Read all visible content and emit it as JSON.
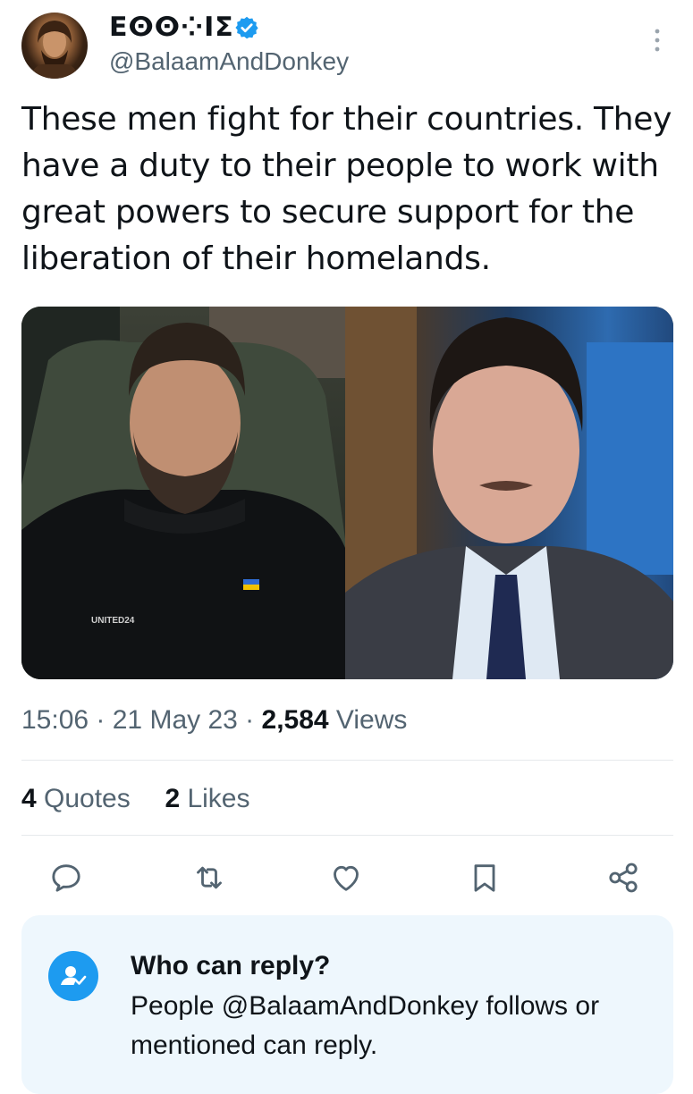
{
  "author": {
    "display_name": "ⴹⵙⵙ⁘ⵏⵉ",
    "handle": "@BalaamAndDonkey",
    "verified": true
  },
  "tweet": {
    "text": "These men fight for their countries. They have a duty to their people to work with great powers to secure support for the liberation of their homelands."
  },
  "media": {
    "left_photo_caption": "UNITED24"
  },
  "meta": {
    "time": "15:06",
    "sep1": " · ",
    "date": "21 May 23",
    "sep2": " · ",
    "views_count": "2,584",
    "views_label": " Views"
  },
  "stats": {
    "quotes_count": "4",
    "quotes_label": " Quotes",
    "likes_count": "2",
    "likes_label": " Likes"
  },
  "actions": {
    "icons": [
      "reply-icon",
      "retweet-icon",
      "like-icon",
      "bookmark-icon",
      "share-icon"
    ]
  },
  "reply_settings": {
    "title": "Who can reply?",
    "text": "People @BalaamAndDonkey follows or mentioned can reply."
  },
  "colors": {
    "accent": "#1d9bf0",
    "muted": "#536471",
    "text": "#0f1419",
    "card_bg": "#eef7fd"
  }
}
